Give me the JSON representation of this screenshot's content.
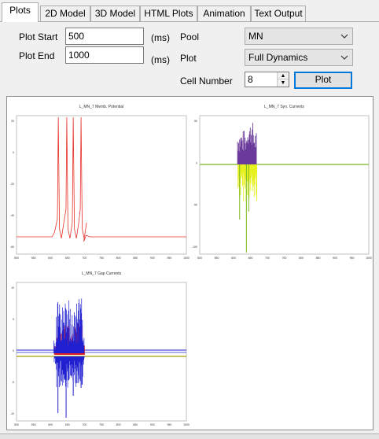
{
  "tabs": [
    "Plots",
    "2D Model",
    "3D Model",
    "HTML Plots",
    "Animation",
    "Text Output"
  ],
  "active_tab": 0,
  "form": {
    "plot_start_label": "Plot Start",
    "plot_start_value": "500",
    "plot_end_label": "Plot End",
    "plot_end_value": "1000",
    "unit_start": "(ms)",
    "unit_end": "(ms)",
    "pool_label": "Pool",
    "pool_value": "MN",
    "plot_label": "Plot",
    "plot_value": "Full Dynamics",
    "cell_number_label": "Cell Number",
    "cell_number_value": "8",
    "plot_button": "Plot"
  },
  "plots": {
    "membrane_title": "L_MN_7 Memb. Potential",
    "syn_title": "L_MN_7 Syn. Currents",
    "gap_title": "L_MN_7 Gap Currents",
    "x_ticks": [
      "500",
      "550",
      "600",
      "650",
      "700",
      "750",
      "800",
      "850",
      "900",
      "950",
      "1000"
    ],
    "membrane_y_ticks": [
      "20",
      "0",
      "-20",
      "-40",
      "-60"
    ],
    "syn_y_ticks": [
      "50",
      "0",
      "-50",
      "-100"
    ],
    "gap_y_ticks": [
      "10",
      "5",
      "0",
      "-5",
      "-10"
    ]
  },
  "colors": {
    "membrane": "#e8302a",
    "syn_pos": "#6a3a9a",
    "syn_neg": "#e8f020",
    "syn_base": "#7ab820",
    "gap_blue": "#2020d0",
    "gap_red": "#e02020",
    "gap_base": "#a8a000"
  }
}
